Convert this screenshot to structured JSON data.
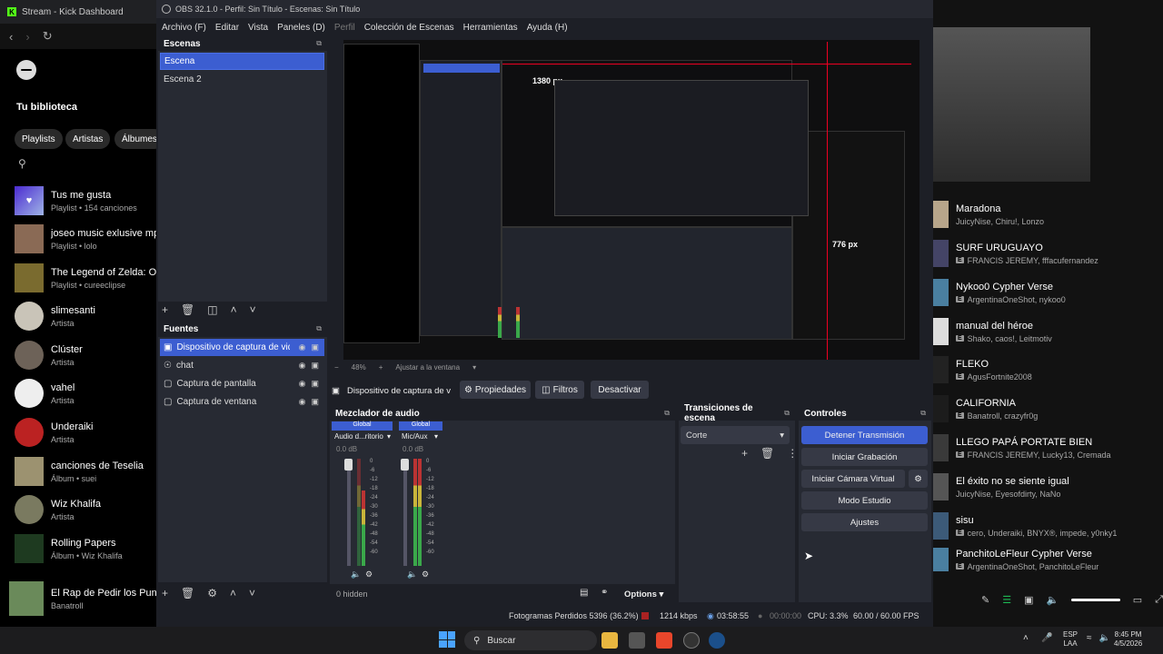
{
  "browser": {
    "tab_title": "Stream - Kick Dashboard"
  },
  "spotify": {
    "library_title": "Tu biblioteca",
    "chips": [
      "Playlists",
      "Artistas",
      "Álbumes"
    ],
    "items": [
      {
        "title": "Tus me gusta",
        "sub": "Playlist • 154 canciones"
      },
      {
        "title": "joseo music exlusive mp",
        "sub": "Playlist • lolo"
      },
      {
        "title": "The Legend of Zelda: Oc",
        "sub": "Playlist • cureeclipse"
      },
      {
        "title": "slimesanti",
        "sub": "Artista"
      },
      {
        "title": "Clúster",
        "sub": "Artista"
      },
      {
        "title": "vahel",
        "sub": "Artista"
      },
      {
        "title": "Underaiki",
        "sub": "Artista"
      },
      {
        "title": "canciones de Teselia",
        "sub": "Álbum • suei"
      },
      {
        "title": "Wiz Khalifa",
        "sub": "Artista"
      },
      {
        "title": "Rolling Papers",
        "sub": "Álbum • Wiz Khalifa"
      }
    ],
    "now_playing": {
      "title": "El Rap de Pedir los Puntos",
      "artist": "Banatroll"
    }
  },
  "obs": {
    "title": "OBS 32.1.0 - Perfil: Sin Título - Escenas: Sin Título",
    "menu": [
      "Archivo (F)",
      "Editar",
      "Vista",
      "Paneles (D)",
      "Perfil",
      "Colección de Escenas",
      "Herramientas",
      "Ayuda (H)"
    ],
    "scenes_title": "Escenas",
    "scenes": [
      "Escena",
      "Escena 2"
    ],
    "sources_title": "Fuentes",
    "sources": [
      "Dispositivo de captura de video",
      "chat",
      "Captura de pantalla",
      "Captura de ventana"
    ],
    "preview": {
      "zoom": "48%",
      "fit": "Ajustar a la ventana",
      "marker_px_wide": "1380 px",
      "marker_px_tall": "776 px"
    },
    "source_bar": {
      "name": "Dispositivo de captura de v",
      "props": "Propiedades",
      "filters": "Filtros",
      "deactivate": "Desactivar"
    },
    "mixer": {
      "title": "Mezclador de audio",
      "channels": [
        {
          "group": "Global",
          "name": "Audio d...ritorio",
          "db": "0.0 dB"
        },
        {
          "group": "Global",
          "name": "Mic/Aux",
          "db": "0.0 dB"
        }
      ],
      "scale": [
        "0",
        "-6",
        "-12",
        "-18",
        "-24",
        "-30",
        "-36",
        "-42",
        "-48",
        "-54",
        "-60"
      ],
      "hidden": "0 hidden",
      "options": "Options"
    },
    "transitions": {
      "title": "Transiciones de escena",
      "value": "Corte"
    },
    "controls": {
      "title": "Controles",
      "stop_stream": "Detener Transmisión",
      "start_rec": "Iniciar Grabación",
      "virtual_cam": "Iniciar Cámara Virtual",
      "studio": "Modo Estudio",
      "settings": "Ajustes"
    },
    "status": {
      "dropped": "Fotogramas Perdidos 5396 (36.2%)",
      "bitrate": "1214 kbps",
      "stream_time": "03:58:55",
      "rec_time": "00:00:00",
      "cpu": "CPU: 3.3%",
      "fps": "60.00 / 60.00 FPS"
    }
  },
  "playlist": [
    {
      "title": "Maradona",
      "sub": "JuicyNise, Chiru!, Lonzo",
      "explicit": false
    },
    {
      "title": "SURF URUGUAYO",
      "sub": "FRANCIS JEREMY, fffacufernandez",
      "explicit": true
    },
    {
      "title": "Nykoo0 Cypher Verse",
      "sub": "ArgentinaOneShot, nykoo0",
      "explicit": true
    },
    {
      "title": "manual del héroe",
      "sub": "Shako, caos!, Leitmotiv",
      "explicit": true
    },
    {
      "title": "FLEKO",
      "sub": "AgusFortnite2008",
      "explicit": true
    },
    {
      "title": "CALIFORNIA",
      "sub": "Banatroll, crazyfr0g",
      "explicit": true
    },
    {
      "title": "LLEGO PAPÁ PORTATE BIEN",
      "sub": "FRANCIS JEREMY, Lucky13, Cremada",
      "explicit": true
    },
    {
      "title": "El éxito no se siente igual",
      "sub": "JuicyNise, Eyesofdirty, NaNo",
      "explicit": false
    },
    {
      "title": "sisu",
      "sub": "cero, Underaiki, BNYX®, impede, y0nky1",
      "explicit": true
    },
    {
      "title": "PanchitoLeFleur Cypher Verse",
      "sub": "ArgentinaOneShot, PanchitoLeFleur",
      "explicit": true
    }
  ],
  "taskbar": {
    "search": "Buscar",
    "lang": "ESP",
    "lang2": "LAA",
    "time": "8:45 PM",
    "date": "4/5/2026"
  },
  "colors": {
    "accent": "#3c5ed1",
    "spotify_green": "#1db954",
    "kick_green": "#53fc18"
  }
}
